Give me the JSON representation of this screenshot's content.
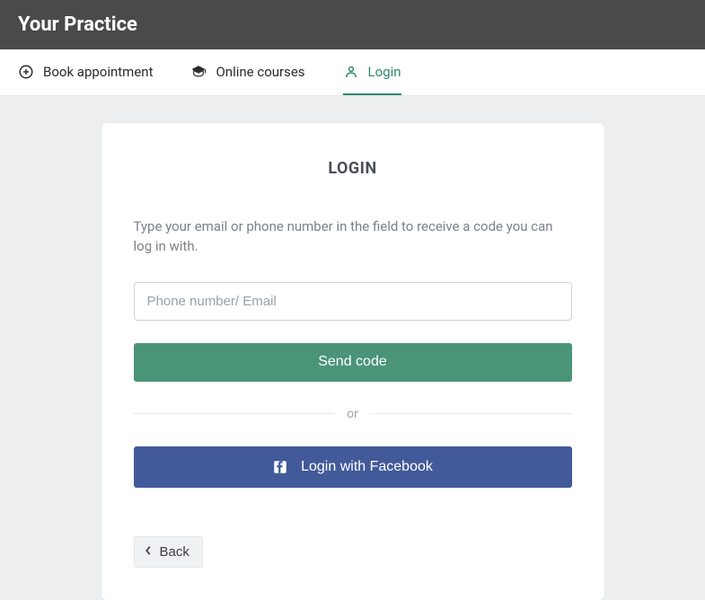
{
  "header": {
    "title": "Your Practice"
  },
  "nav": {
    "tabs": [
      {
        "label": "Book appointment",
        "icon": "plus-circle-icon",
        "active": false
      },
      {
        "label": "Online courses",
        "icon": "graduation-cap-icon",
        "active": false
      },
      {
        "label": "Login",
        "icon": "user-icon",
        "active": true
      }
    ]
  },
  "login": {
    "title": "LOGIN",
    "instruction": "Type your email or phone number in the field to receive a code you can log in with.",
    "input_placeholder": "Phone number/ Email",
    "input_value": "",
    "send_code_label": "Send code",
    "divider_text": "or",
    "facebook_label": "Login with Facebook",
    "back_label": "Back"
  },
  "colors": {
    "header_bg": "#4a4a4a",
    "accent": "#2f8a6f",
    "primary_button": "#4a9478",
    "facebook": "#425a9a"
  }
}
